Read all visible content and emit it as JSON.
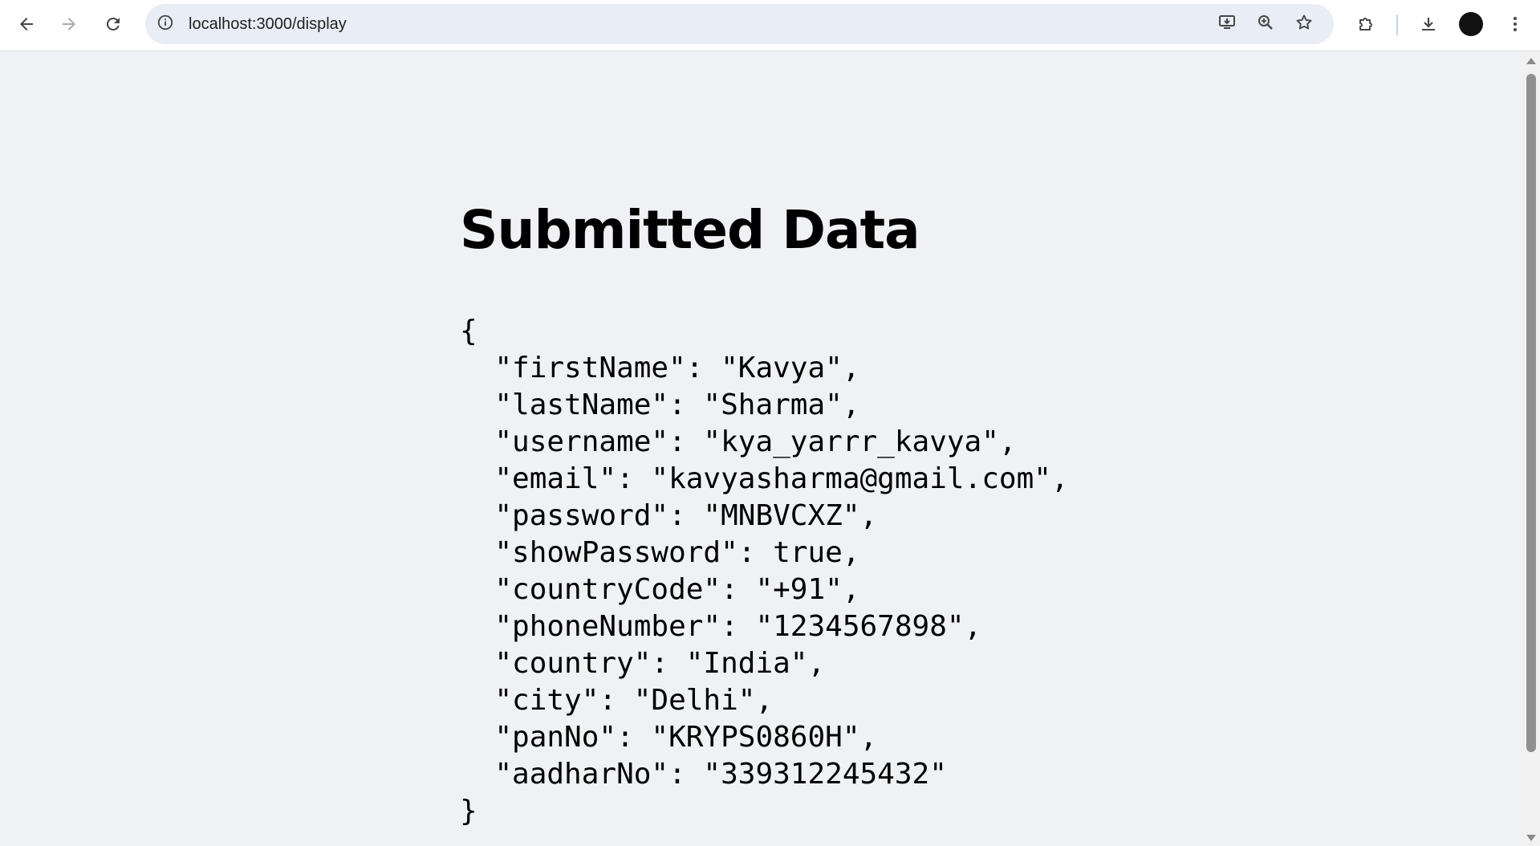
{
  "browser": {
    "url": "localhost:3000/display",
    "icons": {
      "back": "back-arrow-icon",
      "forward": "forward-arrow-icon",
      "reload": "reload-icon",
      "site_info": "info-icon",
      "install": "install-app-icon",
      "zoom": "zoom-icon",
      "bookmark": "star-icon",
      "extensions": "puzzle-icon",
      "downloads": "download-icon",
      "profile": "avatar",
      "menu": "kebab-menu-icon"
    }
  },
  "page": {
    "title": "Submitted Data",
    "json_lines": [
      "{",
      "  \"firstName\": \"Kavya\",",
      "  \"lastName\": \"Sharma\",",
      "  \"username\": \"kya_yarrr_kavya\",",
      "  \"email\": \"kavyasharma@gmail.com\",",
      "  \"password\": \"MNBVCXZ\",",
      "  \"showPassword\": true,",
      "  \"countryCode\": \"+91\",",
      "  \"phoneNumber\": \"1234567898\",",
      "  \"country\": \"India\",",
      "  \"city\": \"Delhi\",",
      "  \"panNo\": \"KRYPS0860H\",",
      "  \"aadharNo\": \"339312245432\"",
      "}"
    ]
  },
  "colors": {
    "page_background": "#eff1f5",
    "toolbar_background": "#ffffff",
    "omnibox_background": "#e9edf6",
    "text": "#000000"
  }
}
